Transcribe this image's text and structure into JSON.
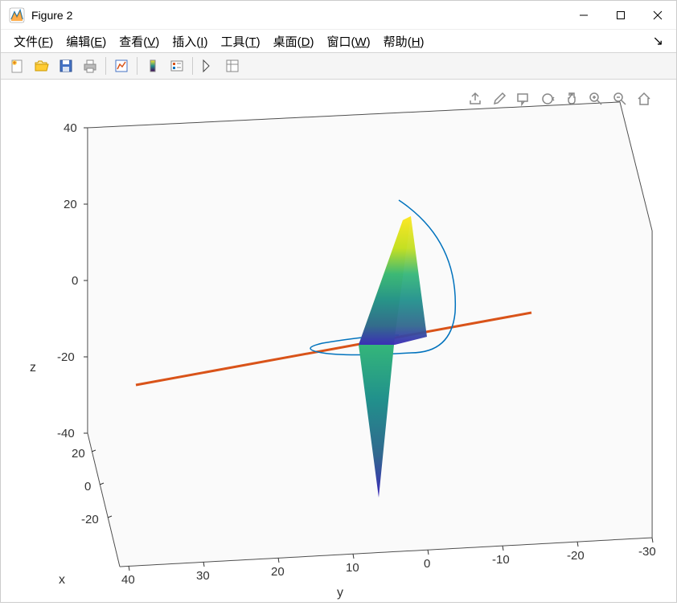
{
  "window": {
    "title": "Figure 2"
  },
  "menu": {
    "file": "文件",
    "file_key": "F",
    "edit": "编辑",
    "edit_key": "E",
    "view": "查看",
    "view_key": "V",
    "insert": "插入",
    "insert_key": "I",
    "tools": "工具",
    "tools_key": "T",
    "desktop": "桌面",
    "desktop_key": "D",
    "window": "窗口",
    "window_key": "W",
    "help": "帮助",
    "help_key": "H"
  },
  "axes": {
    "xlabel": "x",
    "ylabel": "y",
    "zlabel": "z",
    "z_ticks": [
      "40",
      "20",
      "0",
      "-20",
      "-40"
    ],
    "x_ticks": [
      "20",
      "0",
      "-20"
    ],
    "y_ticks": [
      "40",
      "30",
      "20",
      "10",
      "0",
      "-10",
      "-20",
      "-30"
    ]
  },
  "chart_data": {
    "type": "surface",
    "elements": [
      {
        "kind": "surface",
        "description": "parula-colored triangular/planar surface patch",
        "z_range": [
          -40,
          40
        ],
        "colormap": "parula"
      },
      {
        "kind": "line",
        "description": "straight red line crossing diagonally",
        "color": "#d95319",
        "approx_endpoints": {
          "y_range": [
            -30,
            40
          ],
          "z_near": 0
        }
      },
      {
        "kind": "curve",
        "description": "blue open loop/ellipse curve",
        "color": "#0072bd"
      }
    ],
    "x_range": [
      -20,
      20
    ],
    "y_range": [
      -30,
      40
    ],
    "z_range": [
      -40,
      40
    ]
  }
}
